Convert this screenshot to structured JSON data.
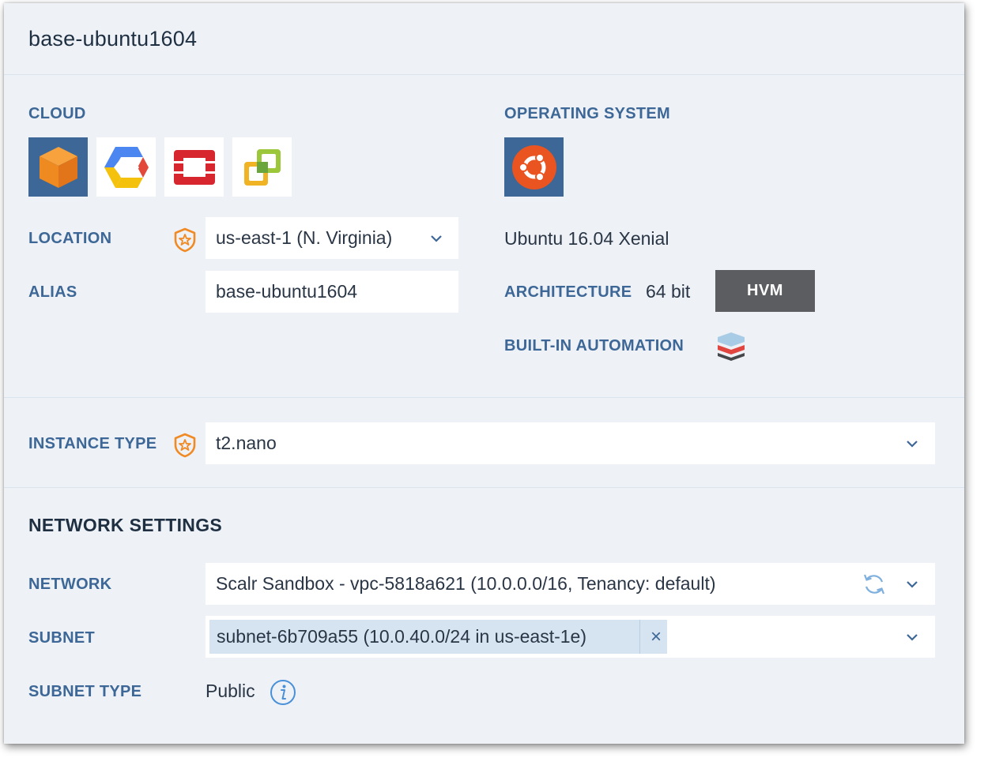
{
  "header": {
    "title": "base-ubuntu1604"
  },
  "cloud": {
    "label": "CLOUD",
    "platforms": [
      {
        "name": "aws-icon",
        "selected": true
      },
      {
        "name": "google-cloud-icon",
        "selected": false
      },
      {
        "name": "openstack-icon",
        "selected": false
      },
      {
        "name": "vmware-icon",
        "selected": false
      }
    ]
  },
  "location": {
    "label": "LOCATION",
    "value": "us-east-1 (N. Virginia)"
  },
  "alias": {
    "label": "ALIAS",
    "value": "base-ubuntu1604"
  },
  "os": {
    "label": "OPERATING SYSTEM",
    "icon": "ubuntu-icon",
    "name": "Ubuntu 16.04 Xenial",
    "architecture_label": "ARCHITECTURE",
    "architecture_value": "64 bit",
    "virtualization": "HVM",
    "automation_label": "BUILT-IN AUTOMATION",
    "automation_icon": "scalr-agent-icon"
  },
  "instance_type": {
    "label": "INSTANCE TYPE",
    "value": "t2.nano"
  },
  "network_settings": {
    "title": "NETWORK SETTINGS",
    "network_label": "NETWORK",
    "network_value": "Scalr Sandbox - vpc-5818a621 (10.0.0.0/16, Tenancy: default)",
    "subnet_label": "SUBNET",
    "subnet_tag": "subnet-6b709a55 (10.0.40.0/24 in us-east-1e)",
    "subnet_remove": "×",
    "subnet_type_label": "SUBNET TYPE",
    "subnet_type_value": "Public"
  },
  "colors": {
    "panel_bg": "#eef2f7",
    "label_blue": "#3d6796",
    "governance_orange": "#f08a24",
    "hvm_bg": "#5b5d60"
  }
}
